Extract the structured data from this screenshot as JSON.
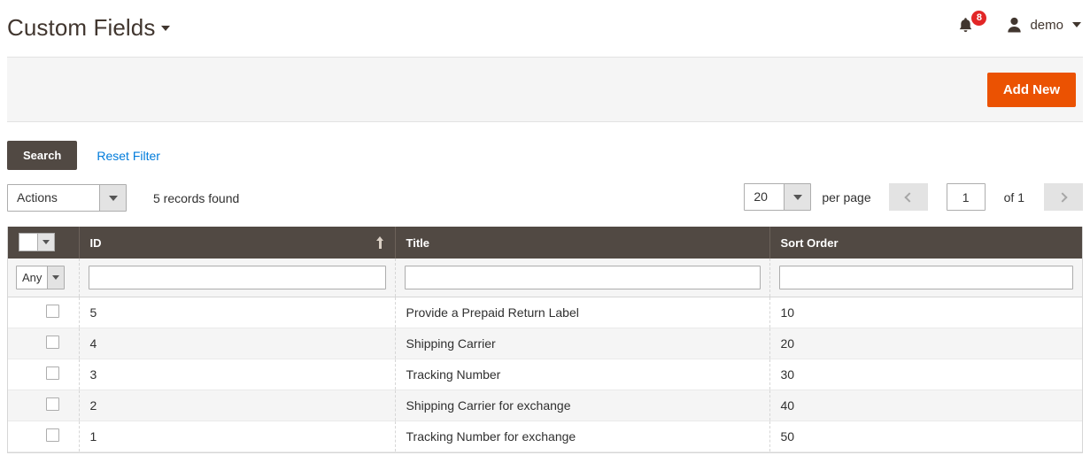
{
  "header": {
    "title": "Custom Fields",
    "title_caret_icon": "chevron-down-icon",
    "bell_icon": "notification-bell-icon",
    "notification_count": "8",
    "user_icon": "user-avatar-icon",
    "user_name": "demo",
    "user_caret_icon": "chevron-down-icon"
  },
  "page_actions": {
    "add_new_label": "Add New",
    "accent_color": "#eb5202"
  },
  "search": {
    "search_label": "Search",
    "reset_filter_label": "Reset Filter",
    "search_button_color": "#514943",
    "reset_link_color": "#007bdb"
  },
  "toolbar": {
    "actions_value": "Actions",
    "records_found": "5 records found",
    "per_page_value": "20",
    "per_page_label": "per page",
    "prev_icon": "chevron-left-icon",
    "next_icon": "chevron-right-icon",
    "current_page": "1",
    "of_label": "of 1"
  },
  "grid": {
    "mass_select_icon": "checkbox-dropdown-icon",
    "columns": [
      {
        "key": "check",
        "label": ""
      },
      {
        "key": "id",
        "label": "ID",
        "sorted": "asc",
        "sort_icon": "sort-arrow-up-icon"
      },
      {
        "key": "title",
        "label": "Title"
      },
      {
        "key": "sort_order",
        "label": "Sort Order"
      }
    ],
    "filters": {
      "any_value": "Any",
      "id_value": "",
      "title_value": "",
      "sort_order_value": ""
    },
    "rows": [
      {
        "id": "5",
        "title": "Provide a Prepaid Return Label",
        "sort_order": "10"
      },
      {
        "id": "4",
        "title": "Shipping Carrier",
        "sort_order": "20"
      },
      {
        "id": "3",
        "title": "Tracking Number",
        "sort_order": "30"
      },
      {
        "id": "2",
        "title": "Shipping Carrier for exchange",
        "sort_order": "40"
      },
      {
        "id": "1",
        "title": "Tracking Number for exchange",
        "sort_order": "50"
      }
    ]
  }
}
